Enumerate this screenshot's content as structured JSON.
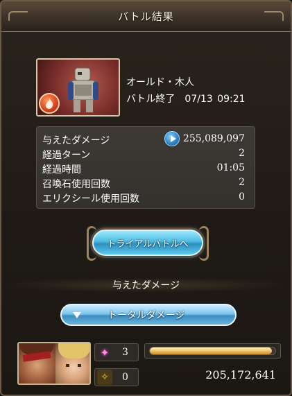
{
  "window": {
    "title": "バトル結果"
  },
  "boss": {
    "name": "オールド・木人",
    "status": "バトル終了　07/13 09:21",
    "element_icon": "fire-element-icon"
  },
  "stats": [
    {
      "label": "与えたダメージ",
      "value": "255,089,097"
    },
    {
      "label": "経過ターン",
      "value": "2"
    },
    {
      "label": "経過時間",
      "value": "01:05"
    },
    {
      "label": "召喚石使用回数",
      "value": "2"
    },
    {
      "label": "エリクシール使用回数",
      "value": "0"
    }
  ],
  "trial_button": {
    "label": "トライアルバトルへ"
  },
  "damage_section": {
    "title": "与えたダメージ"
  },
  "total_button": {
    "label": "トータルダメージ"
  },
  "character_row": {
    "crit_count": "3",
    "guard_count": "0",
    "damage_share": 0.97,
    "damage": "205,172,641"
  },
  "colors": {
    "accent_blue": "#4fbbe0",
    "bar_gold": "#f2c36a",
    "frame_border": "#6b5a45"
  }
}
